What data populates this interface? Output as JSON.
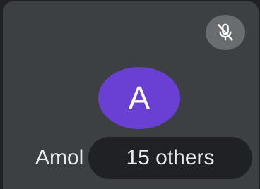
{
  "tile": {
    "participant_name": "Amol",
    "avatar_initial": "A",
    "avatar_color": "#6a3fd3",
    "mic_state_icon": "mic-off-icon",
    "others_label": "15 others"
  },
  "colors": {
    "tile_background": "#3c4043",
    "chip_background": "#202124",
    "badge_background": "#6a6d70",
    "text": "#e8eaed"
  }
}
